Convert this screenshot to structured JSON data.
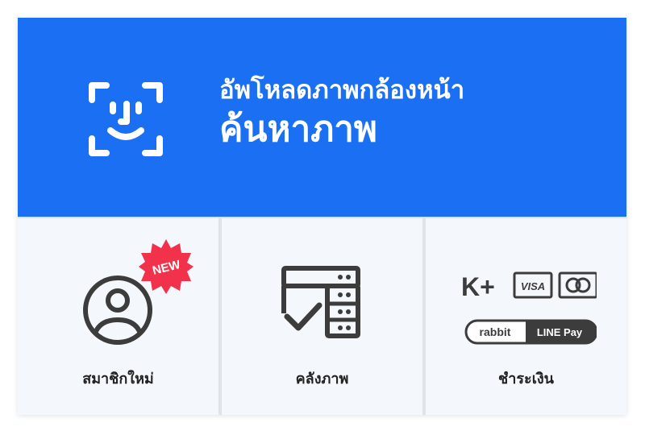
{
  "hero": {
    "line1": "อัพโหลดภาพกล้องหน้า",
    "line2": "ค้นหาภาพ",
    "icon": "face-scan-icon",
    "background": "#1a6ff2"
  },
  "tiles": [
    {
      "label": "สมาชิกใหม่",
      "icon": "user-account-icon",
      "badge": "NEW",
      "badge_color": "#f2324b"
    },
    {
      "label": "คลังภาพ",
      "icon": "storage-check-icon"
    },
    {
      "label": "ชำระเงิน",
      "icon": "payment-methods-icon",
      "payment": {
        "kplus": "K+",
        "visa": "VISA",
        "rabbit": "rabbit",
        "linepay": "LINE Pay"
      }
    }
  ]
}
